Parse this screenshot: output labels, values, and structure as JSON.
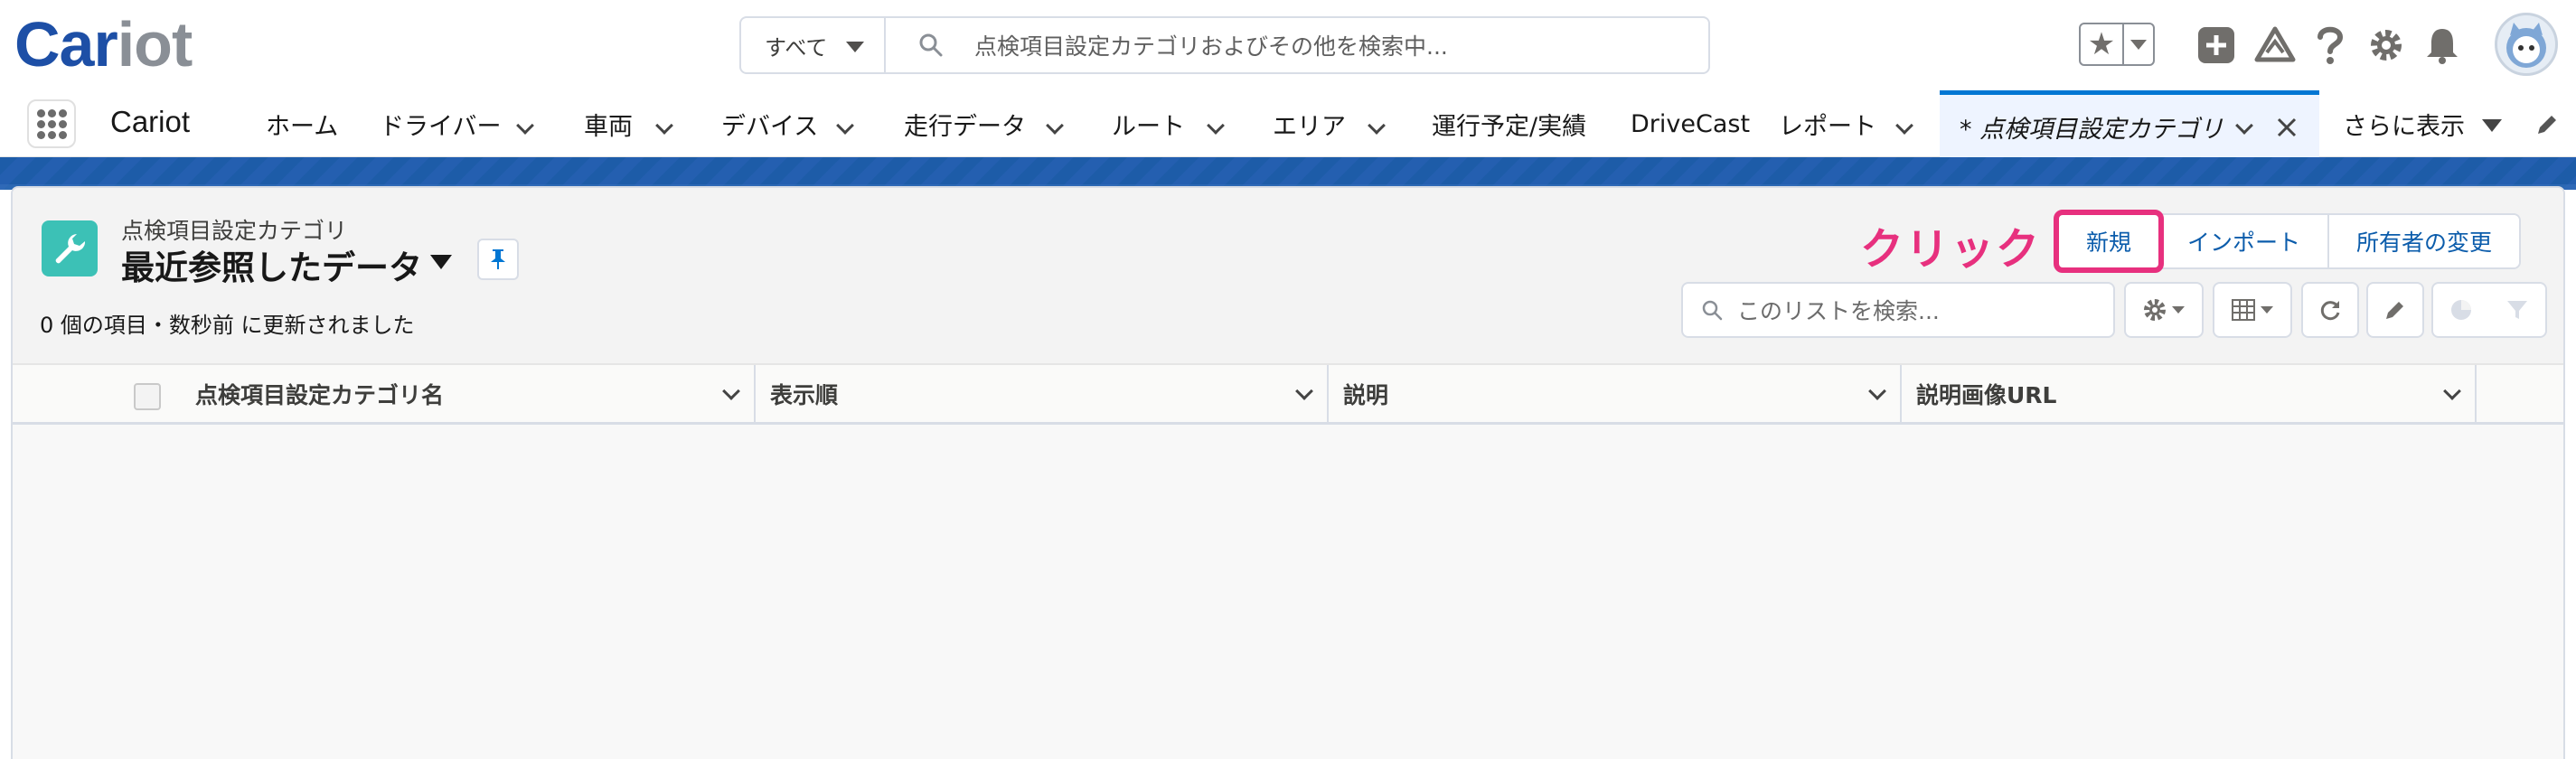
{
  "header": {
    "logo_primary": "Car",
    "logo_secondary": "iot",
    "search_scope": "すべて",
    "search_placeholder": "点検項目設定カテゴリおよびその他を検索中..."
  },
  "nav": {
    "app_name": "Cariot",
    "items": [
      {
        "label": "ホーム"
      },
      {
        "label": "ドライバー"
      },
      {
        "label": "車両"
      },
      {
        "label": "デバイス"
      },
      {
        "label": "走行データ"
      },
      {
        "label": "ルート"
      },
      {
        "label": "エリア"
      },
      {
        "label": "運行予定/実績"
      },
      {
        "label": "DriveCast"
      },
      {
        "label": "レポート"
      }
    ],
    "active_tab": "* 点検項目設定カテゴリ",
    "more": "さらに表示"
  },
  "list_view": {
    "object_type": "点検項目設定カテゴリ",
    "title": "最近参照したデータ",
    "meta": "0 個の項目・数秒前 に更新されました",
    "annotation": "クリック",
    "buttons": {
      "new": "新規",
      "import": "インポート",
      "change_owner": "所有者の変更"
    },
    "search_placeholder": "このリストを検索...",
    "columns": [
      "点検項目設定カテゴリ名",
      "表示順",
      "説明",
      "説明画像URL"
    ]
  },
  "colors": {
    "brand_blue": "#1d4fa6",
    "annotation_pink": "#e7307e",
    "object_icon": "#3cc1b6",
    "link_blue": "#0b5cab"
  }
}
